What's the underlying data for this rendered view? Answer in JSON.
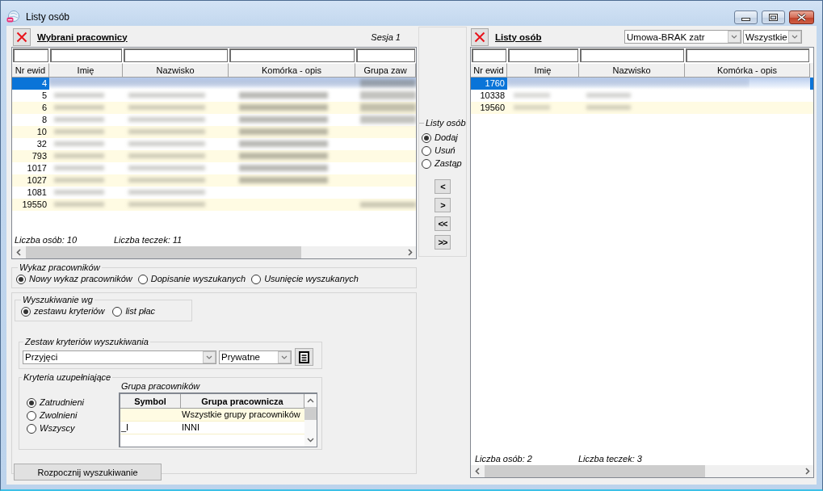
{
  "window": {
    "title": "Listy osób"
  },
  "selected_panel": {
    "title": "Wybrani pracownicy",
    "session": "Sesja 1",
    "columns": [
      "Nr ewid",
      "Imię",
      "Nazwisko",
      "Komórka - opis",
      "Grupa zaw"
    ],
    "rows": [
      {
        "nr_ewid": "4",
        "selected": true
      },
      {
        "nr_ewid": "5",
        "selected": false
      },
      {
        "nr_ewid": "6",
        "selected": false
      },
      {
        "nr_ewid": "8",
        "selected": false
      },
      {
        "nr_ewid": "10",
        "selected": false
      },
      {
        "nr_ewid": "32",
        "selected": false
      },
      {
        "nr_ewid": "793",
        "selected": false
      },
      {
        "nr_ewid": "1017",
        "selected": false
      },
      {
        "nr_ewid": "1027",
        "selected": false
      },
      {
        "nr_ewid": "1081",
        "selected": false
      },
      {
        "nr_ewid": "19550",
        "selected": false
      }
    ],
    "person_count": "Liczba osób: 10",
    "folder_count": "Liczba teczek: 11"
  },
  "transfer": {
    "title": "Listy osób",
    "modes": [
      {
        "label": "Dodaj",
        "selected": true
      },
      {
        "label": "Usuń",
        "selected": false
      },
      {
        "label": "Zastąp",
        "selected": false
      }
    ],
    "buttons": [
      "<",
      ">",
      "<<",
      ">>"
    ]
  },
  "lists_panel": {
    "title": "Listy osób",
    "filters": [
      "Umowa-BRAK zatr",
      "Wszystkie"
    ],
    "columns": [
      "Nr ewid",
      "Imię",
      "Nazwisko",
      "Komórka - opis"
    ],
    "rows": [
      {
        "nr_ewid": "1760",
        "selected": true
      },
      {
        "nr_ewid": "10338",
        "selected": false
      },
      {
        "nr_ewid": "19560",
        "selected": false
      }
    ],
    "person_count": "Liczba osób: 2",
    "folder_count": "Liczba teczek: 3"
  },
  "employee_list": {
    "title": "Wykaz pracowników",
    "options": [
      {
        "label": "Nowy wykaz pracowników",
        "selected": true
      },
      {
        "label": "Dopisanie wyszukanych",
        "selected": false
      },
      {
        "label": "Usunięcie wyszukanych",
        "selected": false
      }
    ]
  },
  "search_by": {
    "title": "Wyszukiwanie wg",
    "options": [
      {
        "label": "zestawu kryteriów",
        "selected": true
      },
      {
        "label": "list płac",
        "selected": false
      }
    ]
  },
  "criteria_set": {
    "title": "Zestaw kryteriów wyszukiwania",
    "set": "Przyjęci",
    "scope": "Prywatne"
  },
  "supplementary": {
    "title": "Kryteria uzupełniające",
    "status_options": [
      {
        "label": "Zatrudnieni",
        "selected": true
      },
      {
        "label": "Zwolnieni",
        "selected": false
      },
      {
        "label": "Wszyscy",
        "selected": false
      }
    ],
    "group_label": "Grupa pracowników",
    "columns": [
      "Symbol",
      "Grupa pracownicza"
    ],
    "rows": [
      {
        "name": "Wszystkie grupy pracowników"
      },
      {
        "symbol": "_I",
        "name": "INNI"
      }
    ]
  },
  "search_button": "Rozpocznij wyszukiwanie"
}
